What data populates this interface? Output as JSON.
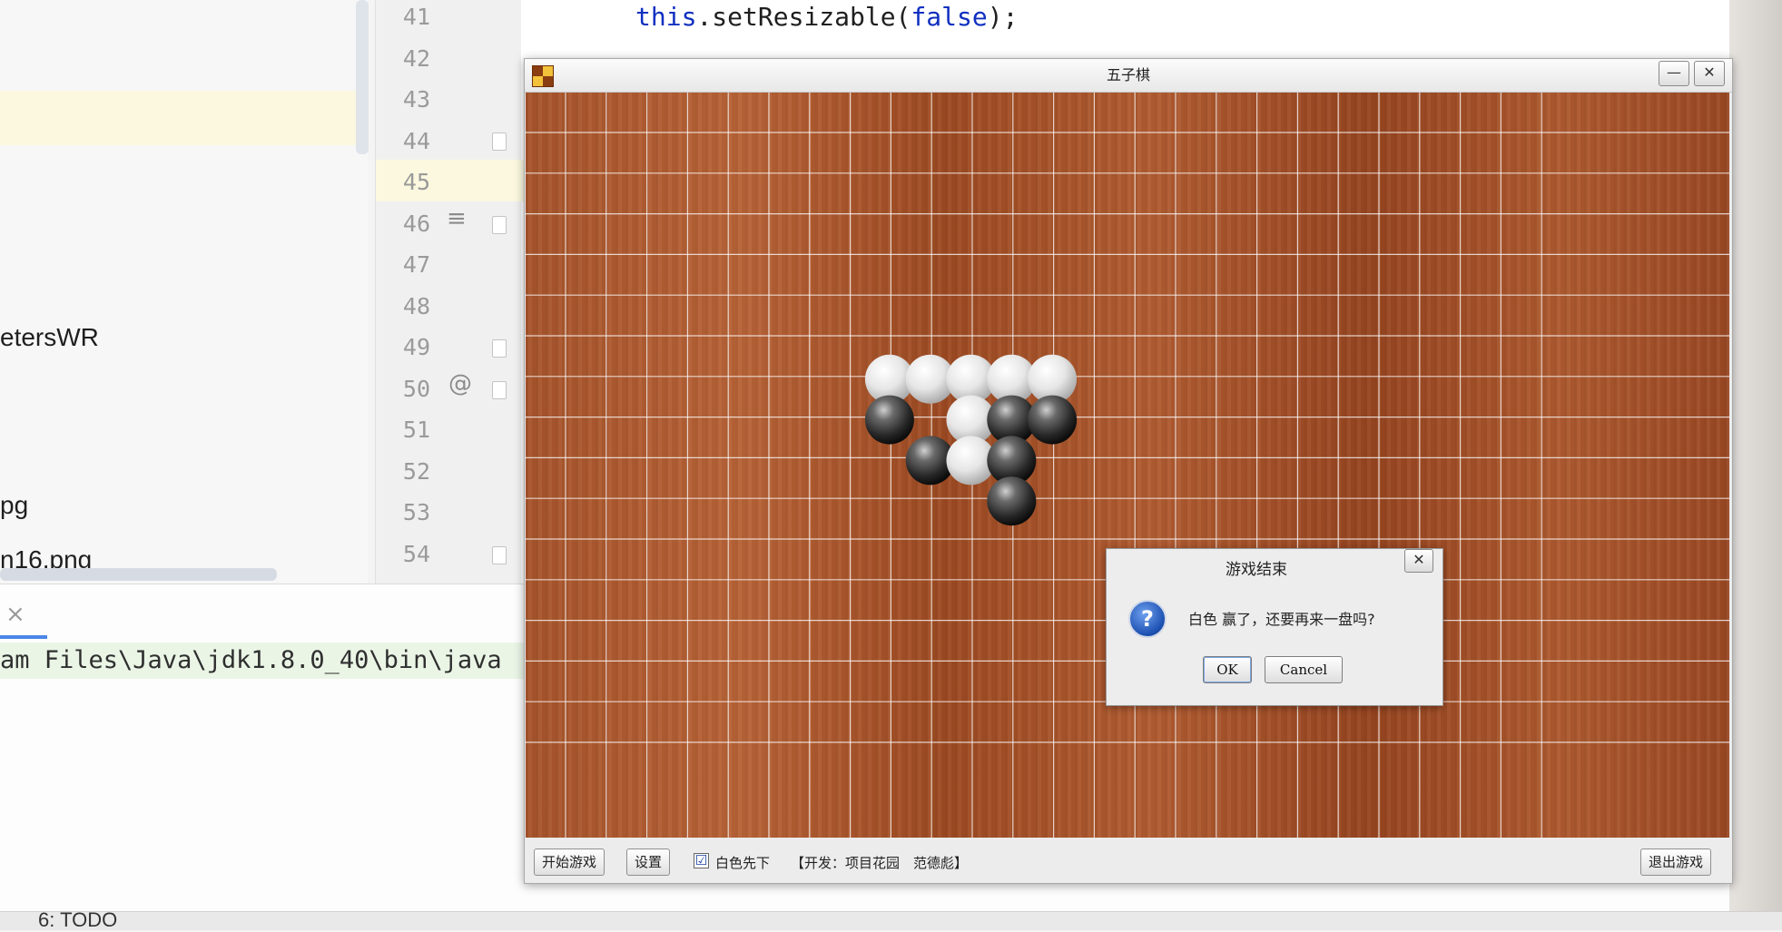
{
  "ide": {
    "project_items": [
      "etersWR",
      "pg",
      "n16.png"
    ],
    "line_numbers": [
      "41",
      "42",
      "43",
      "44",
      "45",
      "46",
      "47",
      "48",
      "49",
      "50",
      "51",
      "52",
      "53",
      "54"
    ],
    "code": {
      "this_kw": "this",
      "method": ".setResizable(",
      "false_kw": "false",
      "end": ");"
    },
    "gutter_at_icon": "@",
    "console_close": "×",
    "console_line": "am Files\\Java\\jdk1.8.0_40\\bin\\java",
    "status_tab": "6: TODO"
  },
  "game": {
    "title": "五子棋",
    "grid_size": 24,
    "window_buttons": {
      "minimize": "—",
      "close": "✕"
    },
    "stones": [
      {
        "col": 8,
        "row": 6,
        "color": "white"
      },
      {
        "col": 9,
        "row": 6,
        "color": "white"
      },
      {
        "col": 10,
        "row": 6,
        "color": "white"
      },
      {
        "col": 11,
        "row": 6,
        "color": "white"
      },
      {
        "col": 12,
        "row": 6,
        "color": "white"
      },
      {
        "col": 8,
        "row": 7,
        "color": "black"
      },
      {
        "col": 10,
        "row": 7,
        "color": "white"
      },
      {
        "col": 11,
        "row": 7,
        "color": "black"
      },
      {
        "col": 12,
        "row": 7,
        "color": "black"
      },
      {
        "col": 9,
        "row": 8,
        "color": "black"
      },
      {
        "col": 10,
        "row": 8,
        "color": "white"
      },
      {
        "col": 11,
        "row": 8,
        "color": "black"
      },
      {
        "col": 11,
        "row": 9,
        "color": "black"
      }
    ],
    "bottom_bar": {
      "start_button": "开始游戏",
      "settings_button": "设置",
      "white_first_checked": "☑",
      "white_first_label": "白色先下",
      "credits": "【开发：项目花园　范德彪】",
      "exit_button": "退出游戏"
    }
  },
  "dialog": {
    "title": "游戏结束",
    "close": "✕",
    "icon": "?",
    "message": "白色 赢了，还要再来一盘吗?",
    "ok": "OK",
    "cancel": "Cancel"
  }
}
